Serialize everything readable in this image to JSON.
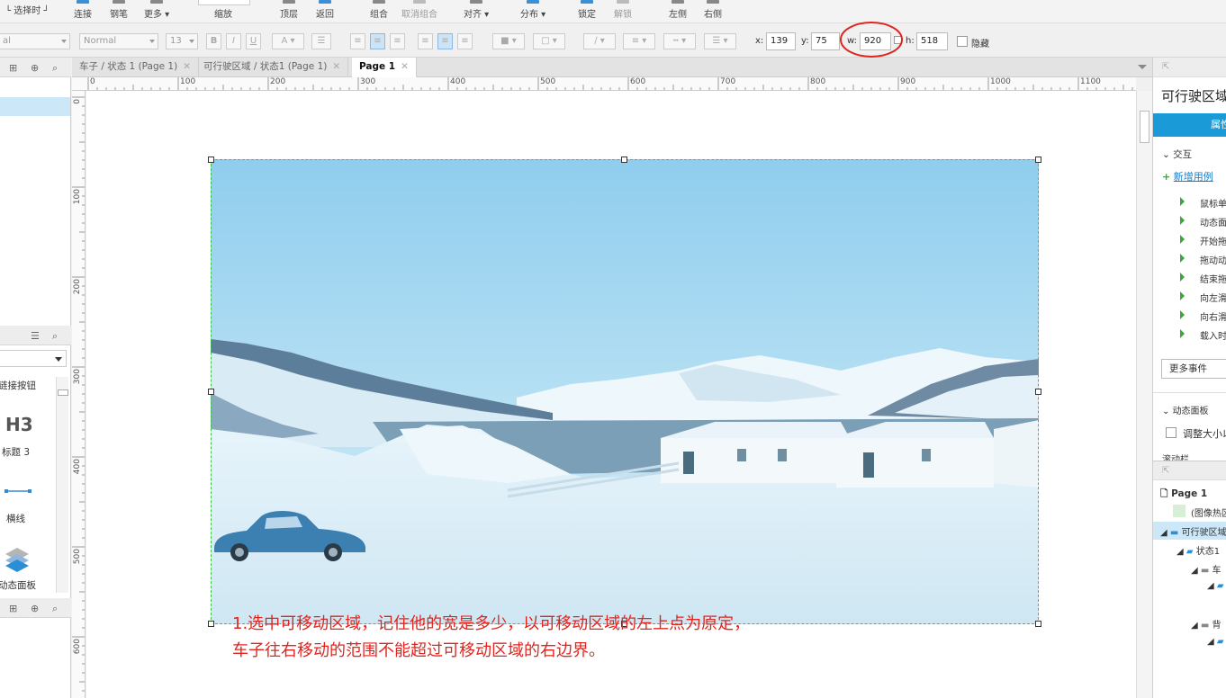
{
  "toolbar_top": {
    "select_mode": "选择时",
    "connect": "连接",
    "pen": "钢笔",
    "more": "更多 ▾",
    "zoom": "缩放",
    "top_layer": "顶层",
    "back": "返回",
    "group": "组合",
    "ungroup": "取消组合",
    "align": "对齐 ▾",
    "distribute": "分布 ▾",
    "lock": "锁定",
    "unlock": "解锁",
    "left": "左侧",
    "right": "右侧"
  },
  "toolbar_format": {
    "style_select": "al",
    "font_style": "Normal",
    "font_size": "13",
    "x_label": "x:",
    "x_value": "139",
    "y_label": "y:",
    "y_value": "75",
    "w_label": "w:",
    "w_value": "920",
    "h_label": "h:",
    "h_value": "518",
    "hidden_label": "隐藏"
  },
  "tabs": [
    {
      "label": "车子 / 状态 1 (Page 1)"
    },
    {
      "label": "可行驶区域 / 状态1 (Page 1)"
    },
    {
      "label": "Page 1"
    }
  ],
  "ruler_h": [
    "0",
    "100",
    "200",
    "300",
    "400",
    "500",
    "600",
    "700",
    "800",
    "900",
    "1000",
    "1100"
  ],
  "ruler_v": [
    "0",
    "100",
    "200",
    "300",
    "400",
    "500",
    "600"
  ],
  "library": {
    "link_button": "链接按钮",
    "h3_glyph": "H3",
    "heading3": "标题 3",
    "hline": "横线",
    "dynamic_panel": "动态面板"
  },
  "annotation": {
    "line1": "1.选中可移动区域，记住他的宽是多少，以可移动区域的左上点为原定，",
    "line2": "车子往右移动的范围不能超过可移动区域的右边界。"
  },
  "inspector": {
    "title": "可行驶区域",
    "tab_properties": "属性",
    "interactions": "交互",
    "add_case": "新增用例",
    "events": [
      "鼠标单击时",
      "动态面板状态改变时",
      "开始拖动时",
      "拖动动态面板时",
      "结束拖动时",
      "向左滑动时",
      "向右滑动时",
      "载入时"
    ],
    "more_events": "更多事件",
    "dynamic_panel_section": "动态面板",
    "resize_content": "调整大小以适合内容",
    "scrollbar": "滚动栏"
  },
  "outline": {
    "page": "Page 1",
    "hotspot": "(图像热区)",
    "panel": "可行驶区域",
    "state": "状态1",
    "car": "车",
    "bg": "背"
  },
  "colors": {
    "accent": "#1a9ad6",
    "annotation_red": "#e0251f",
    "highlight_circle": "#e0251f",
    "selection_green": "#3ec43e"
  }
}
